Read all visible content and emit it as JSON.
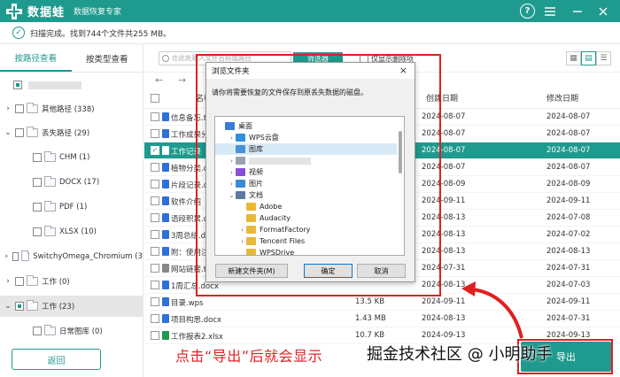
{
  "app": {
    "name": "数据蛙",
    "subtitle": "数据恢复专家",
    "help_icon": "?",
    "colors": {
      "accent": "#1e9a8e",
      "highlight": "#e02020"
    }
  },
  "status": {
    "text": "扫描完成。找到744个文件共255 MB。"
  },
  "sidebar": {
    "tabs": [
      {
        "label": "按路径查看",
        "active": true
      },
      {
        "label": "按类型查看",
        "active": false
      }
    ],
    "tree": [
      {
        "label": "",
        "indent": 0,
        "caret": "",
        "checkbox": "partial",
        "folder": false
      },
      {
        "label": "其他路径 (338)",
        "indent": 1,
        "caret": "›",
        "checkbox": "empty",
        "folder": true
      },
      {
        "label": "丢失路径 (29)",
        "indent": 1,
        "caret": "⌄",
        "checkbox": "empty",
        "folder": true
      },
      {
        "label": "CHM (1)",
        "indent": 2,
        "caret": "",
        "checkbox": "empty",
        "folder": true
      },
      {
        "label": "DOCX (17)",
        "indent": 2,
        "caret": "",
        "checkbox": "empty",
        "folder": true
      },
      {
        "label": "PDF (1)",
        "indent": 2,
        "caret": "",
        "checkbox": "empty",
        "folder": true
      },
      {
        "label": "XLSX (10)",
        "indent": 2,
        "caret": "",
        "checkbox": "empty",
        "folder": true
      },
      {
        "label": "SwitchyOmega_Chromium (3",
        "indent": 1,
        "caret": "›",
        "checkbox": "empty",
        "folder": true
      },
      {
        "label": "工作 (0)",
        "indent": 1,
        "caret": "›",
        "checkbox": "empty",
        "folder": true
      },
      {
        "label": "工作 (23)",
        "indent": 1,
        "caret": "⌄",
        "checkbox": "partial",
        "folder": true,
        "selected": true
      },
      {
        "label": "日常图库 (0)",
        "indent": 2,
        "caret": "",
        "checkbox": "empty",
        "folder": true
      }
    ],
    "back_label": "返回"
  },
  "filterbar": {
    "search_placeholder": "在此处输入文件名称或路径",
    "filter_label": "筛选器",
    "show_deleted_label": "仅显示删除项"
  },
  "table": {
    "headers": {
      "name": "名称",
      "created": "创建日期",
      "modified": "修改日期"
    },
    "rows": [
      {
        "name": "信息备忘.t",
        "size": "",
        "created": "2024-08-07",
        "modified": "2024-08-07",
        "icon": "#2f6fd8"
      },
      {
        "name": "工作成果分",
        "size": "",
        "created": "2024-08-07",
        "modified": "2024-08-07",
        "icon": "#2f6fd8"
      },
      {
        "name": "工作记录",
        "size": "",
        "created": "2024-08-07",
        "modified": "2024-08-07",
        "icon": "#2f6fd8",
        "selected": true
      },
      {
        "name": "植物分类.d",
        "size": "",
        "created": "2024-08-07",
        "modified": "2024-08-07",
        "icon": "#2f6fd8"
      },
      {
        "name": "片段记录.d",
        "size": "",
        "created": "2024-08-09",
        "modified": "2024-08-09",
        "icon": "#2f6fd8"
      },
      {
        "name": "软件介绍",
        "size": "",
        "created": "2024-09-11",
        "modified": "2024-09-11",
        "icon": "#2f6fd8"
      },
      {
        "name": "语段积累.d",
        "size": "",
        "created": "2024-08-13",
        "modified": "2024-07-08",
        "icon": "#2f6fd8"
      },
      {
        "name": "3周总结.do",
        "size": "",
        "created": "2024-08-13",
        "modified": "2024-07-02",
        "icon": "#2f6fd8"
      },
      {
        "name": "附：使用注",
        "size": "",
        "created": "2024-08-13",
        "modified": "2024-08-13",
        "icon": "#2f6fd8"
      },
      {
        "name": "网站链接.t",
        "size": "",
        "created": "2024-07-31",
        "modified": "2024-07-31",
        "icon": "#888888"
      },
      {
        "name": "1周汇总.docx",
        "size": "",
        "created": "2024-08-13",
        "modified": "2024-07-03",
        "icon": "#2f6fd8"
      },
      {
        "name": "目录.wps",
        "size": "13.5 KB",
        "created": "2024-09-11",
        "modified": "2024-09-11",
        "icon": "#2f6fd8"
      },
      {
        "name": "项目构思.docx",
        "size": "1.43 MB",
        "created": "2024-08-13",
        "modified": "2024-07-31",
        "icon": "#2f6fd8"
      },
      {
        "name": "工作报表2.xlsx",
        "size": "10.7 KB",
        "created": "2024-09-13",
        "modified": "2024-09-13",
        "icon": "#1e9a4e"
      }
    ]
  },
  "dialog": {
    "title": "浏览文件夹",
    "message": "请你将需要恢复的文件保存到原丢失数据的磁盘。",
    "close_icon": "×",
    "tree": [
      {
        "label": "桌面",
        "indent": 0,
        "caret": "",
        "icon": "#3a7bd5"
      },
      {
        "label": "WPS云盘",
        "indent": 1,
        "caret": "›",
        "icon": "#2f8fe0"
      },
      {
        "label": "图库",
        "indent": 1,
        "caret": "",
        "icon": "#4a90d9",
        "highlight": true
      },
      {
        "label": "",
        "indent": 1,
        "caret": "›",
        "icon": "#9aa4b0"
      },
      {
        "label": "视频",
        "indent": 1,
        "caret": "›",
        "icon": "#8a4fd8"
      },
      {
        "label": "图片",
        "indent": 1,
        "caret": "›",
        "icon": "#3a8ad5"
      },
      {
        "label": "文档",
        "indent": 1,
        "caret": "⌄",
        "icon": "#5a7aa0"
      },
      {
        "label": "Adobe",
        "indent": 2,
        "caret": "",
        "icon": "#e8b838"
      },
      {
        "label": "Audacity",
        "indent": 2,
        "caret": "",
        "icon": "#e8b838"
      },
      {
        "label": "FormatFactory",
        "indent": 2,
        "caret": "›",
        "icon": "#e8b838"
      },
      {
        "label": "Tencent Files",
        "indent": 2,
        "caret": "›",
        "icon": "#e8b838"
      },
      {
        "label": "WPSDrive",
        "indent": 2,
        "caret": "",
        "icon": "#e8b838"
      }
    ],
    "new_folder_label": "新建文件夹(M)",
    "ok_label": "确定",
    "cancel_label": "取消"
  },
  "annotation": {
    "caption": "点击“导出”后就会显示",
    "watermark": "掘金技术社区 @ 小明助手"
  },
  "export_label": "导出"
}
